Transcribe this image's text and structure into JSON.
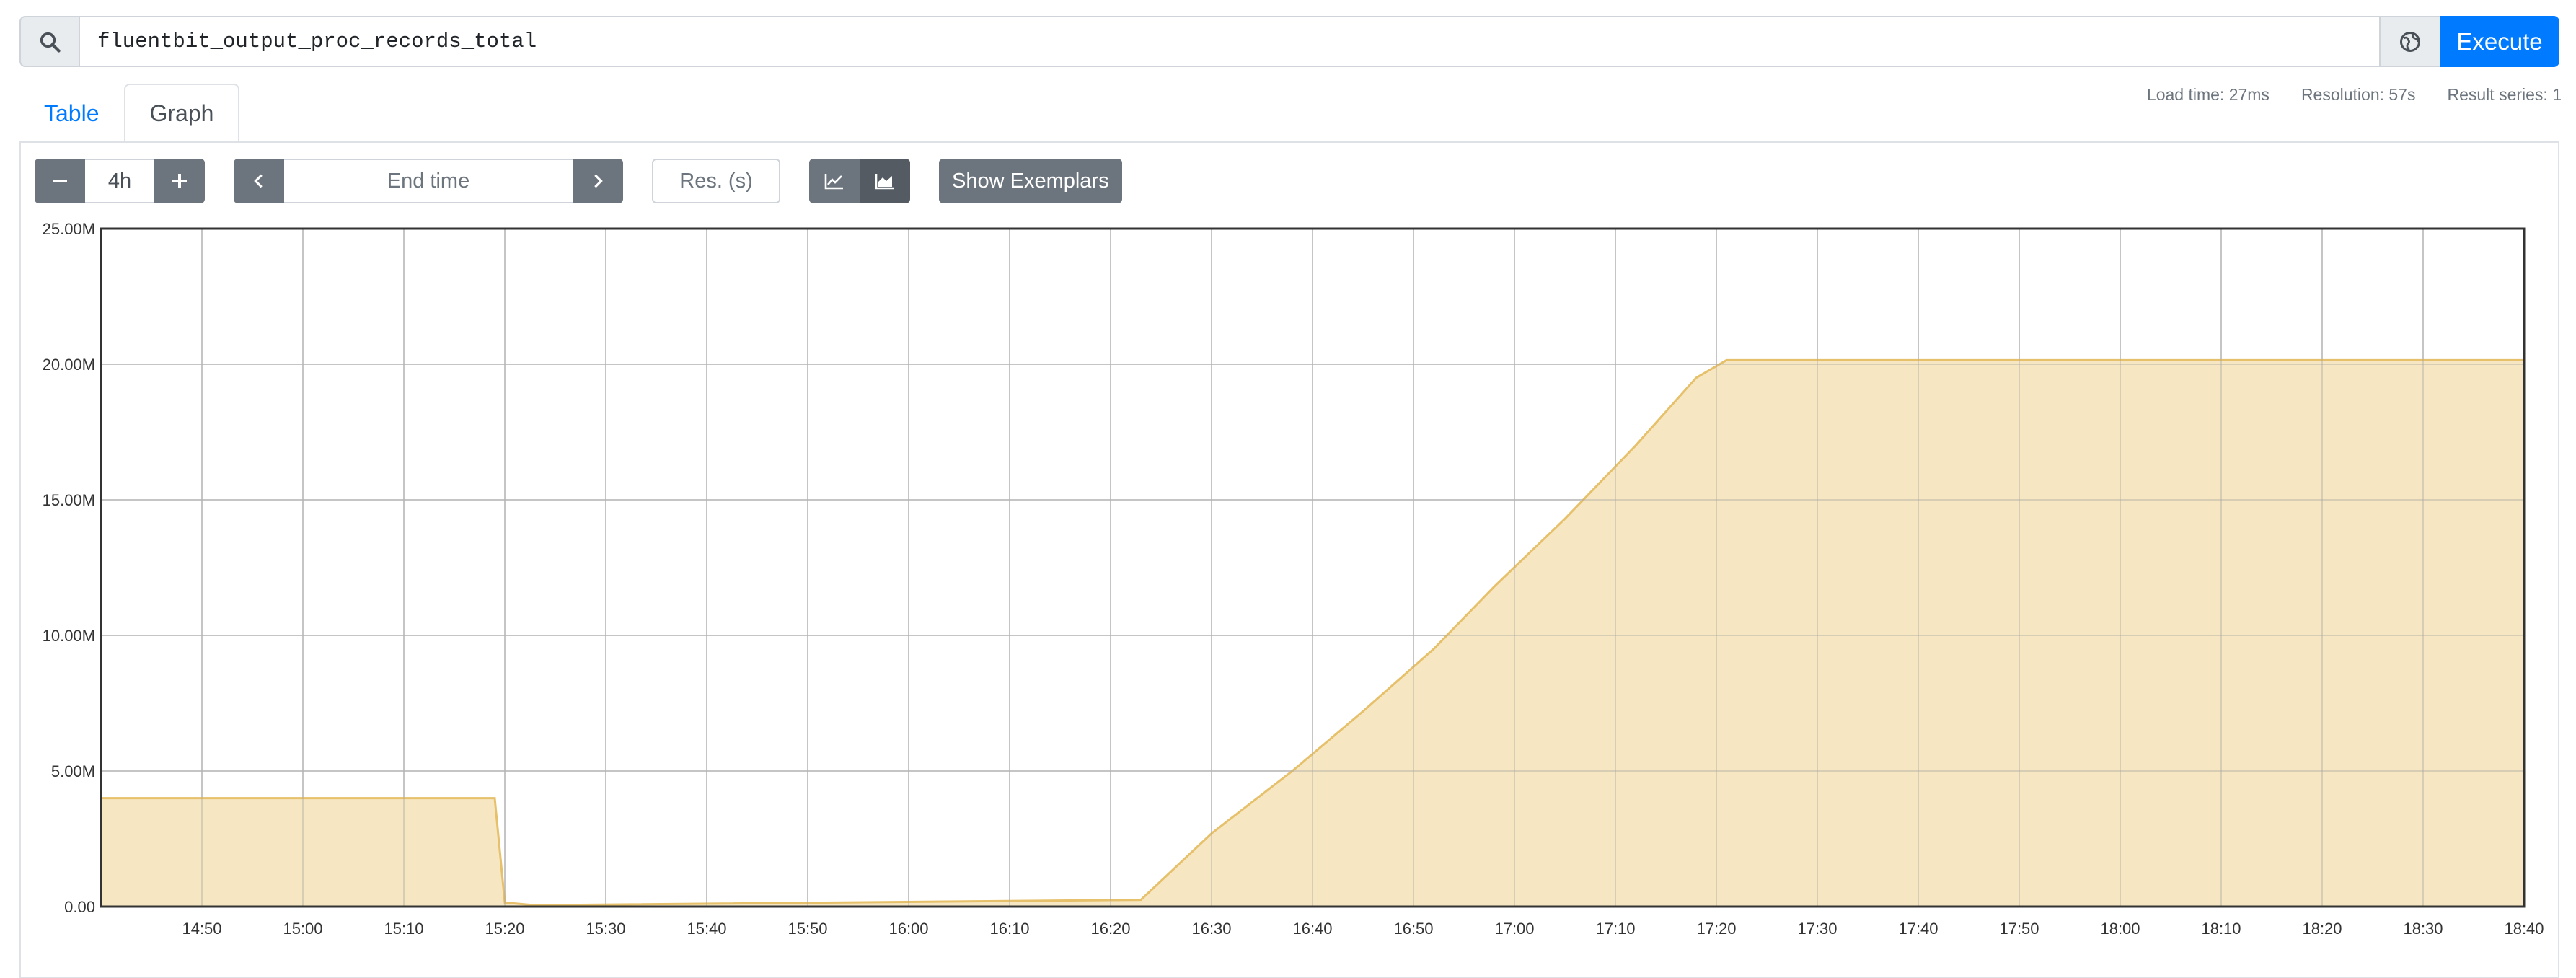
{
  "query": {
    "expression": "fluentbit_output_proc_records_total",
    "execute_label": "Execute",
    "search_icon": "search-icon",
    "explore_icon": "globe-icon"
  },
  "tabs": [
    {
      "label": "Table",
      "active": false
    },
    {
      "label": "Graph",
      "active": true
    }
  ],
  "stats": {
    "load_time": "Load time: 27ms",
    "resolution": "Resolution: 57s",
    "result_series": "Result series: 1"
  },
  "controls": {
    "range_value": "4h",
    "end_time_placeholder": "End time",
    "resolution_placeholder": "Res. (s)",
    "show_exemplars_label": "Show Exemplars"
  },
  "colors": {
    "series_line": "#e6c06a",
    "series_fill": "#f5e6bf",
    "accent": "#007bff"
  },
  "chart_data": {
    "type": "area",
    "x_unit": "minutes since 14:40",
    "x_ticks": [
      "14:50",
      "15:00",
      "15:10",
      "15:20",
      "15:30",
      "15:40",
      "15:50",
      "16:00",
      "16:10",
      "16:20",
      "16:30",
      "16:40",
      "16:50",
      "17:00",
      "17:10",
      "17:20",
      "17:30",
      "17:40",
      "17:50",
      "18:00",
      "18:10",
      "18:20",
      "18:30",
      "18:40"
    ],
    "y_ticks": [
      "0.00",
      "5.00M",
      "10.00M",
      "15.00M",
      "20.00M",
      "25.00M"
    ],
    "ylim": [
      0,
      25000000
    ],
    "series": [
      {
        "points": [
          [
            "14:40",
            4000000
          ],
          [
            "15:19",
            4000000
          ],
          [
            "15:20",
            150000
          ],
          [
            "15:23",
            50000
          ],
          [
            "16:23",
            250000
          ],
          [
            "16:30",
            2700000
          ],
          [
            "16:38",
            5000000
          ],
          [
            "16:45",
            7200000
          ],
          [
            "16:52",
            9500000
          ],
          [
            "16:58",
            11800000
          ],
          [
            "17:05",
            14300000
          ],
          [
            "17:12",
            17000000
          ],
          [
            "17:18",
            19500000
          ],
          [
            "17:21",
            20150000
          ],
          [
            "18:40",
            20150000
          ]
        ]
      }
    ]
  }
}
